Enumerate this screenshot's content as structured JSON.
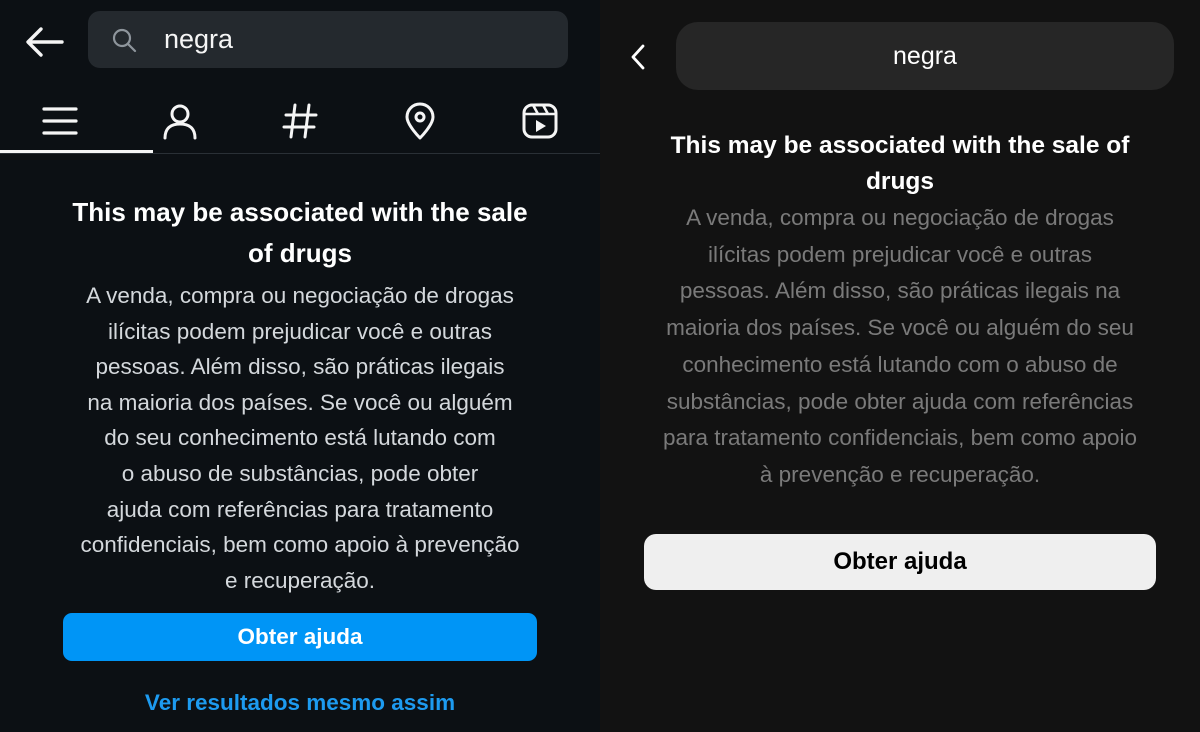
{
  "left_panel": {
    "search": {
      "query": "negra",
      "icon": "search-icon"
    },
    "back_icon": "arrow-left-icon",
    "tabs": [
      {
        "name": "top",
        "icon": "menu-icon",
        "active": true
      },
      {
        "name": "accounts",
        "icon": "person-icon",
        "active": false
      },
      {
        "name": "tags",
        "icon": "hashtag-icon",
        "active": false
      },
      {
        "name": "places",
        "icon": "location-pin-icon",
        "active": false
      },
      {
        "name": "reels",
        "icon": "reels-icon",
        "active": false
      }
    ],
    "warning": {
      "title_line1": "This may be associated with the sale",
      "title_line2": "of drugs",
      "body_lines": [
        "A venda, compra ou negociação de drogas",
        "ilícitas podem prejudicar você e outras",
        "pessoas. Além disso, são práticas ilegais",
        "na maioria dos países. Se você ou alguém",
        "do seu conhecimento está lutando com",
        "o abuso de substâncias, pode obter",
        "ajuda com referências para tratamento",
        "confidenciais, bem como apoio à prevenção",
        "e recuperação."
      ]
    },
    "help_button": "Obter ajuda",
    "see_results_link": "Ver resultados mesmo assim",
    "colors": {
      "background": "#0c1014",
      "accent": "#0095f6",
      "link": "#1d9bf0"
    }
  },
  "right_panel": {
    "search": {
      "query": "negra"
    },
    "back_icon": "chevron-left-icon",
    "warning": {
      "title_line1": "This may be associated with the sale of",
      "title_line2": "drugs",
      "body_lines": [
        "A venda, compra ou negociação de drogas",
        "ilícitas podem prejudicar você e outras",
        "pessoas. Além disso, são práticas ilegais na",
        "maioria dos países. Se você ou alguém do seu",
        "conhecimento está lutando com o abuso de",
        "substâncias, pode obter ajuda com referências",
        "para tratamento confidenciais, bem como apoio",
        "à prevenção e recuperação."
      ]
    },
    "help_button": "Obter ajuda",
    "colors": {
      "background": "#121212",
      "button": "#efefef"
    }
  }
}
